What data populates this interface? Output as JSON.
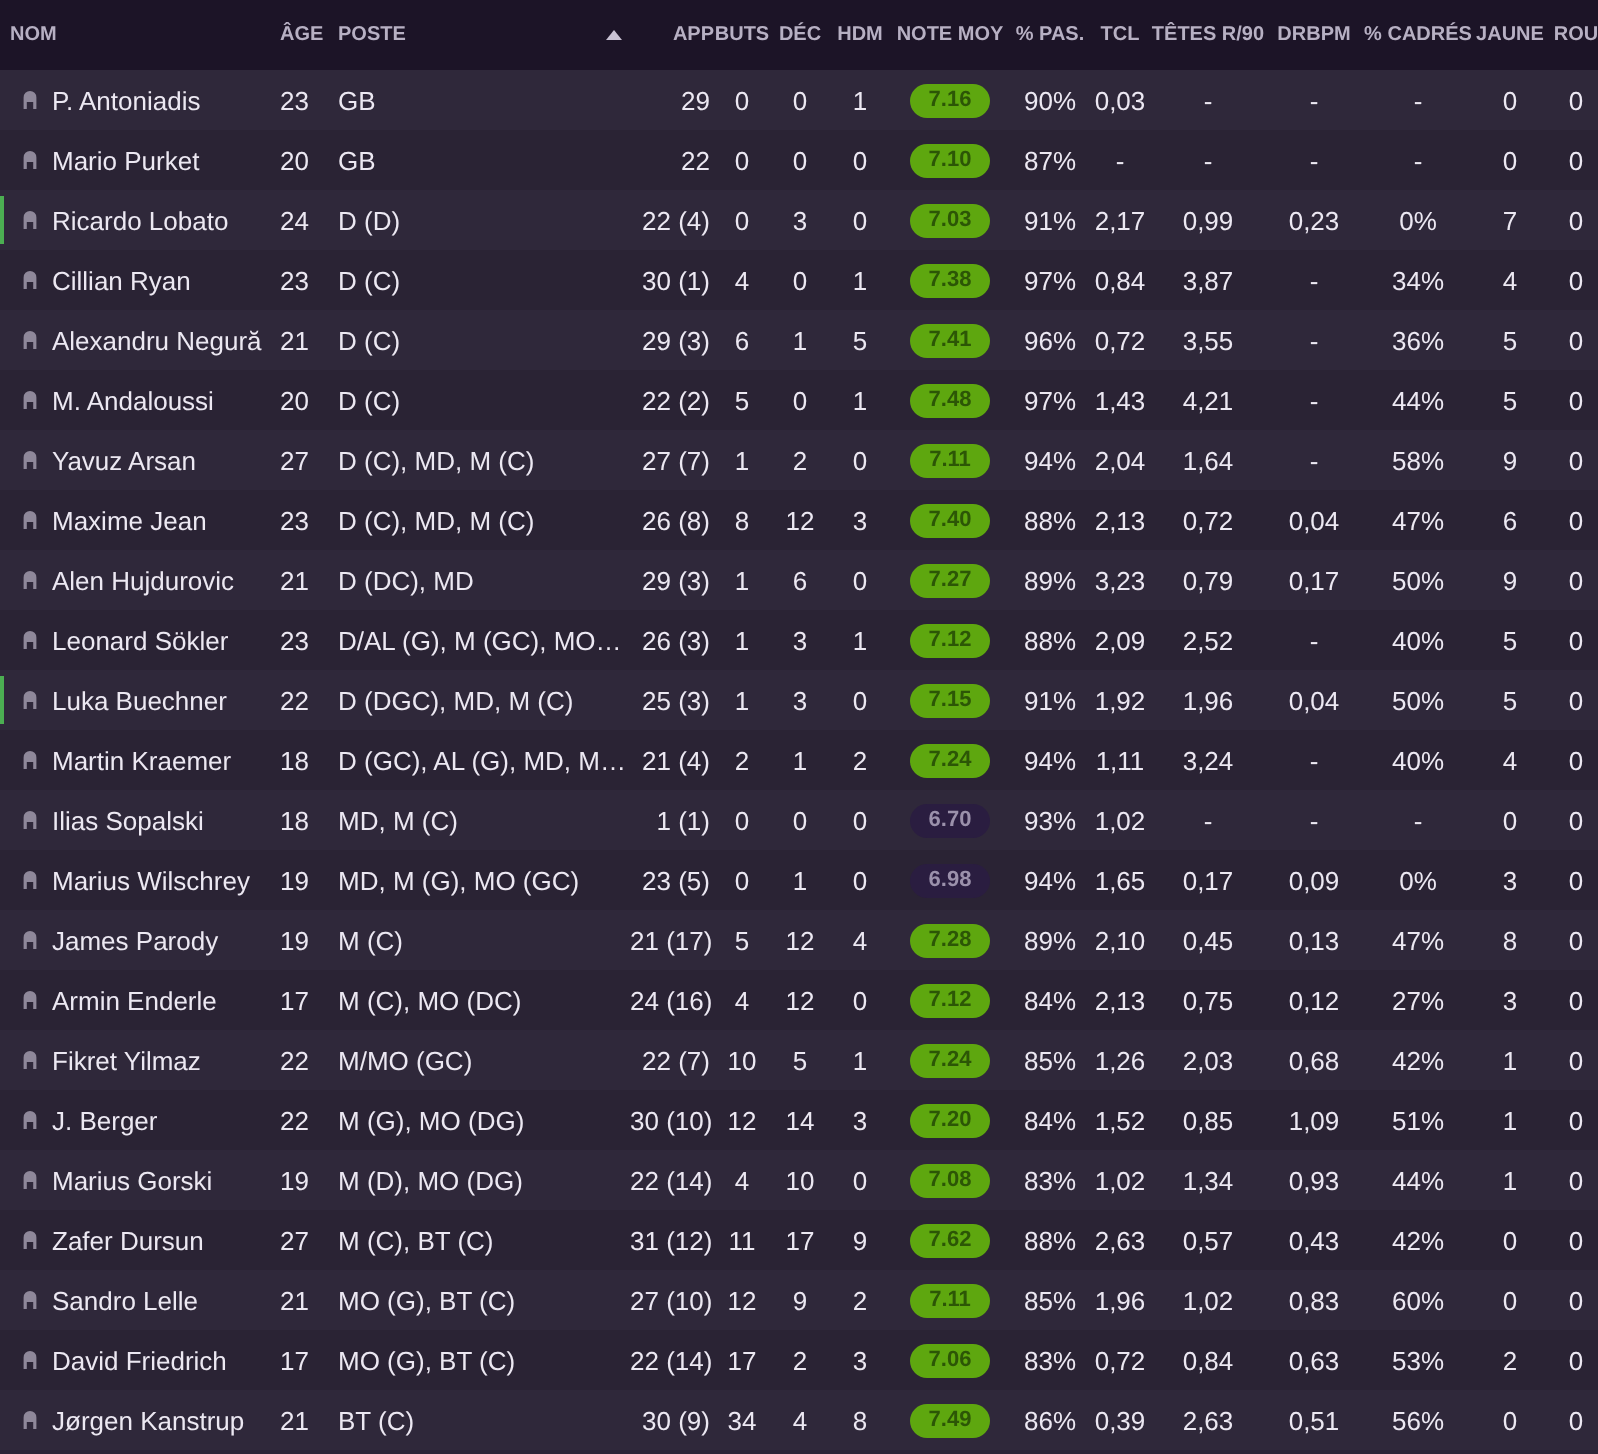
{
  "columns": [
    {
      "label": "NOM",
      "kind": "name",
      "sorted": false
    },
    {
      "label": "ÂGE",
      "kind": "text",
      "sorted": false
    },
    {
      "label": "POSTE",
      "kind": "text",
      "sorted": true
    },
    {
      "label": "APP",
      "kind": "right",
      "sorted": false
    },
    {
      "label": "BUTS",
      "kind": "center",
      "sorted": false
    },
    {
      "label": "DÉC",
      "kind": "center",
      "sorted": false
    },
    {
      "label": "HDM",
      "kind": "center",
      "sorted": false
    },
    {
      "label": "NOTE MOY",
      "kind": "rating",
      "sorted": false
    },
    {
      "label": "% PAS.",
      "kind": "center",
      "sorted": false
    },
    {
      "label": "TCL",
      "kind": "center",
      "sorted": false
    },
    {
      "label": "TÊTES R/90",
      "kind": "center",
      "sorted": false
    },
    {
      "label": "DRBPM",
      "kind": "center",
      "sorted": false
    },
    {
      "label": "% CADRÉS",
      "kind": "center",
      "sorted": false
    },
    {
      "label": "JAUNE",
      "kind": "center",
      "sorted": false
    },
    {
      "label": "ROU",
      "kind": "center",
      "sorted": false
    }
  ],
  "rows": [
    {
      "marked": false,
      "color": "#5ea70f",
      "cells": [
        "P. Antoniadis",
        "23",
        "GB",
        "29",
        "0",
        "0",
        "1",
        "7.16",
        "90%",
        "0,03",
        "-",
        "-",
        "-",
        "0",
        "0"
      ]
    },
    {
      "marked": false,
      "color": "#5ea70f",
      "cells": [
        "Mario Purket",
        "20",
        "GB",
        "22",
        "0",
        "0",
        "0",
        "7.10",
        "87%",
        "-",
        "-",
        "-",
        "-",
        "0",
        "0"
      ]
    },
    {
      "marked": true,
      "color": "#5ea70f",
      "cells": [
        "Ricardo Lobato",
        "24",
        "D (D)",
        "22 (4)",
        "0",
        "3",
        "0",
        "7.03",
        "91%",
        "2,17",
        "0,99",
        "0,23",
        "0%",
        "7",
        "0"
      ]
    },
    {
      "marked": false,
      "color": "#5ea70f",
      "cells": [
        "Cillian Ryan",
        "23",
        "D (C)",
        "30 (1)",
        "4",
        "0",
        "1",
        "7.38",
        "97%",
        "0,84",
        "3,87",
        "-",
        "34%",
        "4",
        "0"
      ]
    },
    {
      "marked": false,
      "color": "#5ea70f",
      "cells": [
        "Alexandru Negură",
        "21",
        "D (C)",
        "29 (3)",
        "6",
        "1",
        "5",
        "7.41",
        "96%",
        "0,72",
        "3,55",
        "-",
        "36%",
        "5",
        "0"
      ]
    },
    {
      "marked": false,
      "color": "#5ea70f",
      "cells": [
        "M. Andaloussi",
        "20",
        "D (C)",
        "22 (2)",
        "5",
        "0",
        "1",
        "7.48",
        "97%",
        "1,43",
        "4,21",
        "-",
        "44%",
        "5",
        "0"
      ]
    },
    {
      "marked": false,
      "color": "#5ea70f",
      "cells": [
        "Yavuz Arsan",
        "27",
        "D (C), MD, M (C)",
        "27 (7)",
        "1",
        "2",
        "0",
        "7.11",
        "94%",
        "2,04",
        "1,64",
        "-",
        "58%",
        "9",
        "0"
      ]
    },
    {
      "marked": false,
      "color": "#5ea70f",
      "cells": [
        "Maxime Jean",
        "23",
        "D (C), MD, M (C)",
        "26 (8)",
        "8",
        "12",
        "3",
        "7.40",
        "88%",
        "2,13",
        "0,72",
        "0,04",
        "47%",
        "6",
        "0"
      ]
    },
    {
      "marked": false,
      "color": "#5ea70f",
      "cells": [
        "Alen Hujdurovic",
        "21",
        "D (DC), MD",
        "29 (3)",
        "1",
        "6",
        "0",
        "7.27",
        "89%",
        "3,23",
        "0,79",
        "0,17",
        "50%",
        "9",
        "0"
      ]
    },
    {
      "marked": false,
      "color": "#5ea70f",
      "cells": [
        "Leonard Sökler",
        "23",
        "D/AL (G), M (GC), MO…",
        "26 (3)",
        "1",
        "3",
        "1",
        "7.12",
        "88%",
        "2,09",
        "2,52",
        "-",
        "40%",
        "5",
        "0"
      ]
    },
    {
      "marked": true,
      "color": "#5ea70f",
      "cells": [
        "Luka Buechner",
        "22",
        "D (DGC), MD, M (C)",
        "25 (3)",
        "1",
        "3",
        "0",
        "7.15",
        "91%",
        "1,92",
        "1,96",
        "0,04",
        "50%",
        "5",
        "0"
      ]
    },
    {
      "marked": false,
      "color": "#5ea70f",
      "cells": [
        "Martin Kraemer",
        "18",
        "D (GC), AL (G), MD, M…",
        "21 (4)",
        "2",
        "1",
        "2",
        "7.24",
        "94%",
        "1,11",
        "3,24",
        "-",
        "40%",
        "4",
        "0"
      ]
    },
    {
      "marked": false,
      "color": "#2a1d40",
      "cells": [
        "Ilias Sopalski",
        "18",
        "MD, M (C)",
        "1 (1)",
        "0",
        "0",
        "0",
        "6.70",
        "93%",
        "1,02",
        "-",
        "-",
        "-",
        "0",
        "0"
      ]
    },
    {
      "marked": false,
      "color": "#2a1d40",
      "cells": [
        "Marius Wilschrey",
        "19",
        "MD, M (G), MO (GC)",
        "23 (5)",
        "0",
        "1",
        "0",
        "6.98",
        "94%",
        "1,65",
        "0,17",
        "0,09",
        "0%",
        "3",
        "0"
      ]
    },
    {
      "marked": false,
      "color": "#5ea70f",
      "cells": [
        "James Parody",
        "19",
        "M (C)",
        "21 (17)",
        "5",
        "12",
        "4",
        "7.28",
        "89%",
        "2,10",
        "0,45",
        "0,13",
        "47%",
        "8",
        "0"
      ]
    },
    {
      "marked": false,
      "color": "#5ea70f",
      "cells": [
        "Armin Enderle",
        "17",
        "M (C), MO (DC)",
        "24 (16)",
        "4",
        "12",
        "0",
        "7.12",
        "84%",
        "2,13",
        "0,75",
        "0,12",
        "27%",
        "3",
        "0"
      ]
    },
    {
      "marked": false,
      "color": "#5ea70f",
      "cells": [
        "Fikret Yilmaz",
        "22",
        "M/MO (GC)",
        "22 (7)",
        "10",
        "5",
        "1",
        "7.24",
        "85%",
        "1,26",
        "2,03",
        "0,68",
        "42%",
        "1",
        "0"
      ]
    },
    {
      "marked": false,
      "color": "#5ea70f",
      "cells": [
        "J. Berger",
        "22",
        "M (G), MO (DG)",
        "30 (10)",
        "12",
        "14",
        "3",
        "7.20",
        "84%",
        "1,52",
        "0,85",
        "1,09",
        "51%",
        "1",
        "0"
      ]
    },
    {
      "marked": false,
      "color": "#5ea70f",
      "cells": [
        "Marius Gorski",
        "19",
        "M (D), MO (DG)",
        "22 (14)",
        "4",
        "10",
        "0",
        "7.08",
        "83%",
        "1,02",
        "1,34",
        "0,93",
        "44%",
        "1",
        "0"
      ]
    },
    {
      "marked": false,
      "color": "#5ea70f",
      "cells": [
        "Zafer Dursun",
        "27",
        "M (C), BT (C)",
        "31 (12)",
        "11",
        "17",
        "9",
        "7.62",
        "88%",
        "2,63",
        "0,57",
        "0,43",
        "42%",
        "0",
        "0"
      ]
    },
    {
      "marked": false,
      "color": "#5ea70f",
      "cells": [
        "Sandro Lelle",
        "21",
        "MO (G), BT (C)",
        "27 (10)",
        "12",
        "9",
        "2",
        "7.11",
        "85%",
        "1,96",
        "1,02",
        "0,83",
        "60%",
        "0",
        "0"
      ]
    },
    {
      "marked": false,
      "color": "#5ea70f",
      "cells": [
        "David Friedrich",
        "17",
        "MO (G), BT (C)",
        "22 (14)",
        "17",
        "2",
        "3",
        "7.06",
        "83%",
        "0,72",
        "0,84",
        "0,63",
        "53%",
        "2",
        "0"
      ]
    },
    {
      "marked": false,
      "color": "#5ea70f",
      "cells": [
        "Jørgen Kanstrup",
        "21",
        "BT (C)",
        "30 (9)",
        "34",
        "4",
        "8",
        "7.49",
        "86%",
        "0,39",
        "2,63",
        "0,51",
        "56%",
        "0",
        "0"
      ]
    }
  ]
}
